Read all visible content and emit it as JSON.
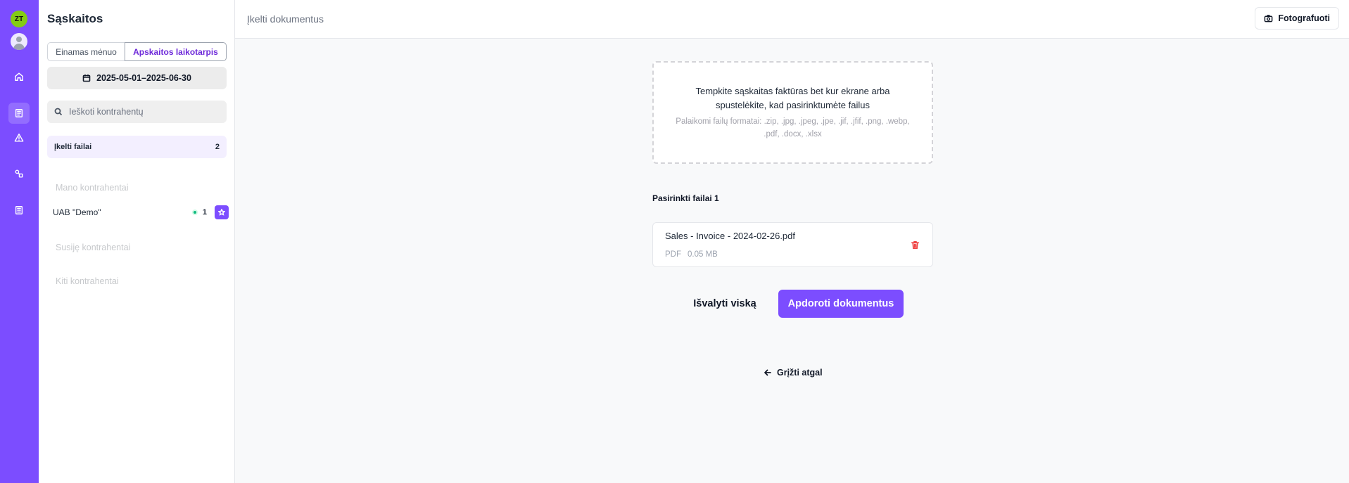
{
  "rail": {
    "user_initials": "ZT",
    "items": [
      {
        "icon": "home-icon"
      },
      {
        "icon": "invoice-icon",
        "active": true
      },
      {
        "icon": "alert-triangle-icon"
      },
      {
        "icon": "shapes-icon"
      },
      {
        "icon": "document-icon"
      }
    ],
    "accent_color": "#7c4dff"
  },
  "sidebar": {
    "title": "Sąskaitos",
    "period_tabs": [
      "Einamas mėnuo",
      "Apskaitos laikotarpis"
    ],
    "active_period_tab": "Apskaitos laikotarpis",
    "date_range": "2025-05-01–2025-06-30",
    "search_placeholder": "Ieškoti kontrahentų",
    "uploaded_label": "Įkelti failai",
    "uploaded_count": "2",
    "sections": {
      "mine": "Mano kontrahentai",
      "related": "Susiję kontrahentai",
      "other": "Kiti kontrahentai"
    },
    "counterparties": [
      {
        "name": "UAB \"Demo\"",
        "count": "1"
      }
    ]
  },
  "header": {
    "title": "Įkelti dokumentus",
    "photo_button": "Fotografuoti"
  },
  "dropzone": {
    "text": "Tempkite sąskaitas faktūras bet kur ekrane arba spustelėkite, kad pasirinktumėte failus",
    "formats": "Palaikomi failų formatai: .zip, .jpg, .jpeg, .jpe, .jif, .jfif, .png, .webp, .pdf, .docx, .xlsx"
  },
  "selected": {
    "label": "Pasirinkti failai 1",
    "files": [
      {
        "name": "Sales - Invoice - 2024-02-26.pdf",
        "type": "PDF",
        "size": "0.05 MB"
      }
    ]
  },
  "actions": {
    "clear": "Išvalyti viską",
    "process": "Apdoroti dokumentus",
    "back": "Grįžti atgal"
  }
}
